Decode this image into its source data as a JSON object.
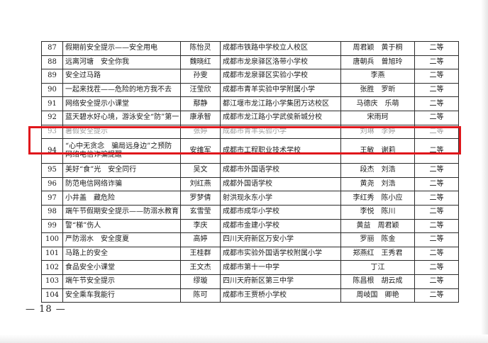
{
  "table": {
    "rows": [
      {
        "no": "87",
        "title": "假期前安全提示——安全用电",
        "author": "陈怡灵",
        "school": "成都市铁路中学校立人校区",
        "teachers": "周君颖　黄于桐",
        "prize": "二等"
      },
      {
        "no": "88",
        "title": "远离河塘　安全你我",
        "author": "魏晓红",
        "school": "成都市龙泉驿区洛带小学校",
        "teachers": "唐朝兵　曾旭玲",
        "prize": "二等"
      },
      {
        "no": "89",
        "title": "安全过马路",
        "author": "孙雯",
        "school": "成都市龙泉驿区实验小学校",
        "teachers": "李燕",
        "prize": "二等"
      },
      {
        "no": "90",
        "title": "一起来找茬——危险的地方我不去",
        "author": "汪莹欣",
        "school": "成都市青羊实验中学附属小学",
        "teachers": "张胜　罗昕",
        "prize": "二等"
      },
      {
        "no": "91",
        "title": "网络安全提示小课堂",
        "author": "鄢静",
        "school": "都江堰市龙江路小学集团万达校区",
        "teachers": "马德庆　乐萌",
        "prize": "二等"
      },
      {
        "no": "92",
        "title": "蓝天碧水好心境，游泳安全“防”第一",
        "author": "康承智",
        "school": "成都市龙江路小学武侯新城分校",
        "teachers": "宋雨珂",
        "prize": "二等"
      },
      {
        "no": "93",
        "title": "暑假安全提示",
        "author": "张婷",
        "school": "成都市青羊实验小学",
        "teachers": "刘琳　李婷",
        "prize": "二等"
      },
      {
        "no": "94",
        "title": "“心中无贪念　骗局远身边”之预防网络电信诈骗提醒",
        "author": "安维军",
        "school": "成都市工程职业技术学校",
        "teachers": "王敏　谢莉",
        "prize": "二等"
      },
      {
        "no": "95",
        "title": "美好“食”光　安全同行",
        "author": "吴文",
        "school": "成都市外国语学校",
        "teachers": "段杰　刘浩",
        "prize": "二等"
      },
      {
        "no": "96",
        "title": "防范电信网络诈骗",
        "author": "刘红燕",
        "school": "成都外国语学校",
        "teachers": "黄尧　刘浩",
        "prize": "二等"
      },
      {
        "no": "97",
        "title": "小井盖　藏危险",
        "author": "罗梦倩",
        "school": "射洪现永东小学",
        "teachers": "李红秀　陈小应",
        "prize": "二等"
      },
      {
        "no": "98",
        "title": "端午节假期安全提示——防溺水教育",
        "author": "玄雪莹",
        "school": "成都市成华小学校",
        "teachers": "李悦　陈川",
        "prize": "二等"
      },
      {
        "no": "99",
        "title": "警“梯”伤人",
        "author": "李庆",
        "school": "成都市金建小学校",
        "teachers": "黄益　周君颖",
        "prize": "二等"
      },
      {
        "no": "100",
        "title": "严防溺水　安全度夏",
        "author": "高婷",
        "school": "四川天府新区万安小学",
        "teachers": "罗丽　陈金",
        "prize": "二等"
      },
      {
        "no": "101",
        "title": "马路上的安全",
        "author": "王桂群",
        "school": "成都市实验外国语学校附属小学",
        "teachers": "郑燕红　王秀君",
        "prize": "二等"
      },
      {
        "no": "102",
        "title": "食品安全小课堂",
        "author": "王文杰",
        "school": "成都市第十一中学",
        "teachers": "丁江",
        "prize": "二等"
      },
      {
        "no": "103",
        "title": "端午节安全提示",
        "author": "缪璇",
        "school": "四川天府新区第三中学",
        "teachers": "陈昌根　胡云成",
        "prize": "二等"
      },
      {
        "no": "104",
        "title": "安全乘车我能行",
        "author": "陈可",
        "school": "成都市王贾桥小学校",
        "teachers": "周岐国　卿艳",
        "prize": "二等"
      }
    ]
  },
  "footer": {
    "page_number": "— 18 —"
  },
  "colors": {
    "highlight": "#e0161b",
    "border": "#2b2b2b"
  }
}
